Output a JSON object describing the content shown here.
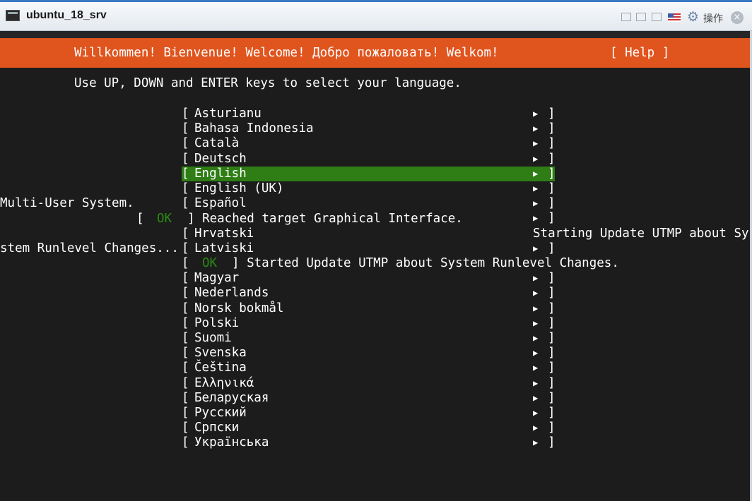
{
  "window": {
    "title": "ubuntu_18_srv",
    "ops_label": "操作",
    "close_glyph": "×"
  },
  "installer": {
    "welcome": "Willkommen! Bienvenue! Welcome! Добро пожаловать! Welkom!",
    "help": "[ Help ]",
    "instructions": "Use UP, DOWN and ENTER keys to select your language.",
    "open_bracket": "[",
    "close_bracket": "]",
    "arrow": "▶",
    "selected_language": "English",
    "colors": {
      "header": "#e0541e",
      "selected": "#2e7d15",
      "ok": "#2c8a12"
    },
    "languages": [
      "Asturianu",
      "Bahasa Indonesia",
      "Català",
      "Deutsch",
      "English",
      "English (UK)",
      "Español",
      "Hrvatski",
      "Latviski",
      "Magyar",
      "Nederlands",
      "Norsk bokmål",
      "Polski",
      "Suomi",
      "Svenska",
      "Čeština",
      "Ελληνικά",
      "Беларуская",
      "Русский",
      "Српски",
      "Українська"
    ]
  },
  "boot_log": {
    "line1": "Multi-User System.",
    "line2_status": "OK",
    "line2_text": "] Reached target Graphical Interface.",
    "line3": "Starting Update UTMP about Sy",
    "line4": "stem Runlevel Changes...",
    "line5_status": "OK",
    "line5_text": "] Started Update UTMP about System Runlevel Changes."
  }
}
